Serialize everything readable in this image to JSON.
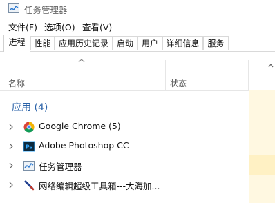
{
  "window": {
    "title": "任务管理器"
  },
  "menu": [
    {
      "label": "文件(F)"
    },
    {
      "label": "选项(O)"
    },
    {
      "label": "查看(V)"
    }
  ],
  "tabs": [
    {
      "label": "进程",
      "active": true
    },
    {
      "label": "性能"
    },
    {
      "label": "应用历史记录"
    },
    {
      "label": "启动"
    },
    {
      "label": "用户"
    },
    {
      "label": "详细信息"
    },
    {
      "label": "服务"
    }
  ],
  "columns": {
    "name": "名称",
    "status": "状态"
  },
  "group": {
    "title": "应用 (4)"
  },
  "processes": [
    {
      "name": "Google Chrome (5)",
      "icon": "chrome-icon"
    },
    {
      "name": "Adobe Photoshop CC",
      "icon": "photoshop-icon"
    },
    {
      "name": "任务管理器",
      "icon": "task-manager-icon"
    },
    {
      "name": "网络编辑超级工具箱---大海加...",
      "icon": "pen-tool-icon"
    }
  ],
  "colors": {
    "accent": "#2a62a8",
    "cpu_heat_light": "#fff8e1",
    "cpu_heat_mid": "#fff1c4"
  }
}
